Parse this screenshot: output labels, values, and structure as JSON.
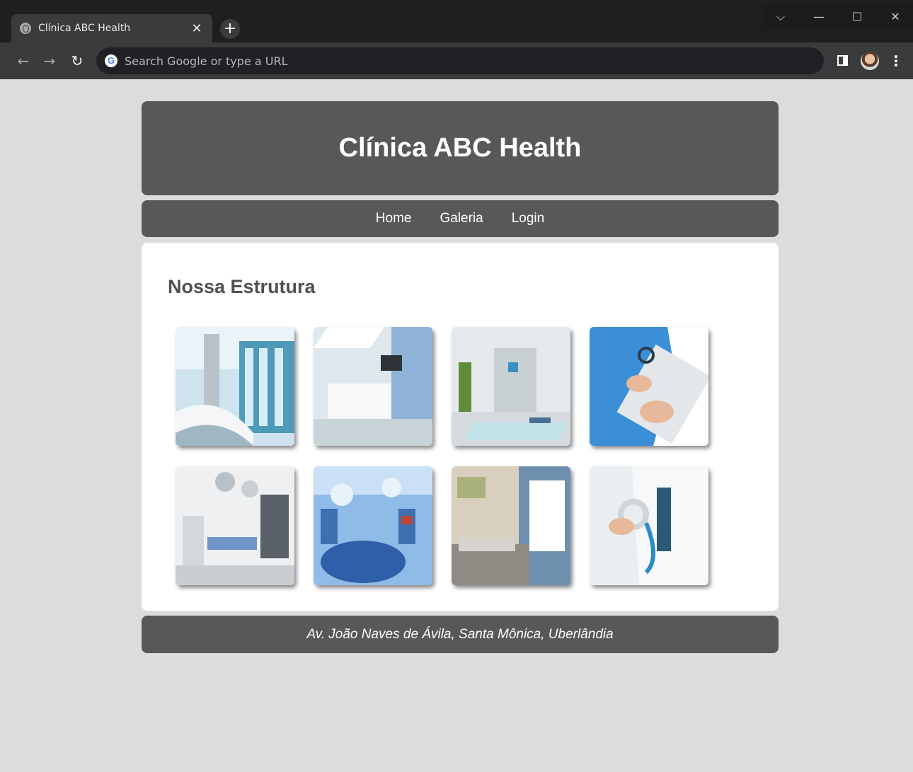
{
  "browser": {
    "tab_title": "Clínica ABC Health",
    "tab_close": "✕",
    "new_tab": "+",
    "omnibox_placeholder": "Search Google or type a URL",
    "google_letter": "G",
    "back_icon": "arrow-left-icon",
    "forward_icon": "arrow-right-icon",
    "reload_icon": "reload-icon",
    "window_controls": [
      "⌵",
      "—",
      "☐",
      "✕"
    ]
  },
  "site": {
    "title": "Clínica ABC Health",
    "nav": [
      "Home",
      "Galeria",
      "Login"
    ],
    "section_title": "Nossa Estrutura",
    "footer": "Av. João Naves de Ávila, Santa Mônica, Uberlândia"
  },
  "gallery": [
    {
      "subject": "curved reception corridor"
    },
    {
      "subject": "white reception lobby"
    },
    {
      "subject": "waiting room with glass table"
    },
    {
      "subject": "nurse writing on clipboard"
    },
    {
      "subject": "operating room equipment"
    },
    {
      "subject": "blue surgery theater"
    },
    {
      "subject": "examination room"
    },
    {
      "subject": "doctor holding stethoscope"
    }
  ],
  "colors": {
    "panel": "#585858",
    "page_bg": "#dcdcdc",
    "card_bg": "#ffffff",
    "heading": "#505050"
  }
}
